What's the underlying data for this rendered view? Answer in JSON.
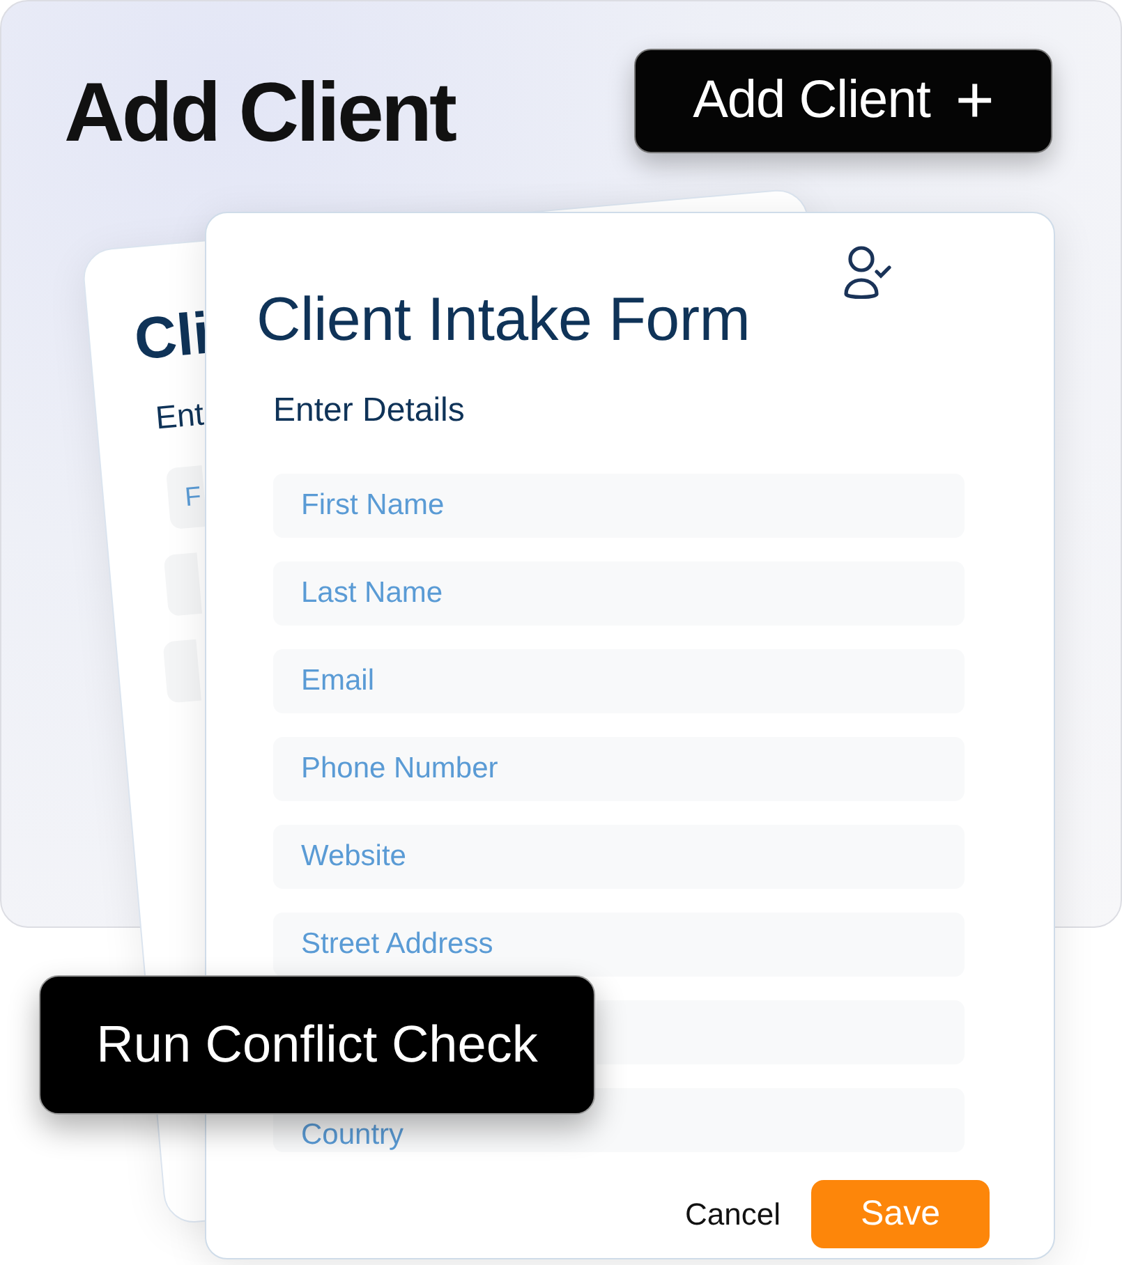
{
  "header": {
    "title": "Add Client",
    "add_button": {
      "label": "Add Client",
      "icon": "+"
    }
  },
  "back_card": {
    "title": "Cli",
    "subtitle": "Ent",
    "field": "F"
  },
  "form": {
    "title": "Client Intake Form",
    "section": "Enter Details",
    "fields": [
      {
        "kind": "full",
        "placeholder": "First Name"
      },
      {
        "kind": "full",
        "placeholder": "Last Name"
      },
      {
        "kind": "full",
        "placeholder": "Email"
      },
      {
        "kind": "full",
        "placeholder": "Phone Number"
      },
      {
        "kind": "full",
        "placeholder": "Website"
      },
      {
        "kind": "full",
        "placeholder": "Street Address"
      },
      {
        "kind": "covered"
      },
      {
        "kind": "low",
        "placeholder": "Country"
      }
    ],
    "buttons": [
      {
        "label": "Cancel",
        "kind": "text"
      },
      {
        "label": "Save",
        "kind": "primary"
      }
    ]
  },
  "overlay_button": {
    "label": "Run Conflict Check"
  }
}
